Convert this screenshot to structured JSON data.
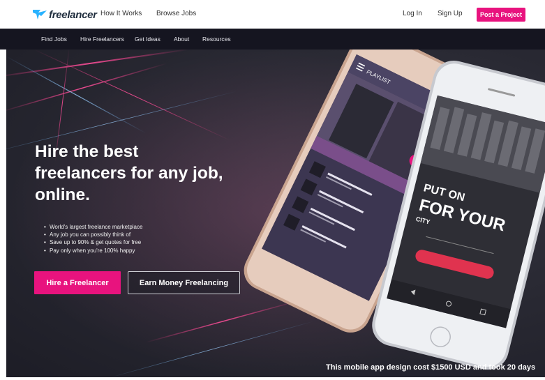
{
  "header": {
    "logo_text": "freelancer",
    "links": [
      "How It Works",
      "Browse Jobs"
    ],
    "login_label": "Log In",
    "signup_label": "Sign Up",
    "post_project_label": "Post a Project"
  },
  "nav": {
    "items": [
      "Find Jobs",
      "Hire Freelancers",
      "Get Ideas",
      "About",
      "Resources"
    ]
  },
  "hero": {
    "headline_lines": [
      "Hire the best",
      "freelancers for any job,",
      "online."
    ],
    "bullets": [
      "World's largest freelance marketplace",
      "Any job you can possibly think of",
      "Save up to 90% & get quotes for free",
      "Pay only when you're 100% happy"
    ],
    "hire_button": "Hire a Freelancer",
    "earn_button": "Earn Money Freelancing",
    "caption": "This mobile app design cost $1500 USD and took 20 days"
  },
  "phone_left": {
    "header": "PLAYLIST"
  },
  "phone_right": {
    "line1": "PUT ON",
    "line2": "FOR YOUR",
    "line3": "CITY"
  },
  "colors": {
    "brand_pink": "#e8137e",
    "nav_dark": "#151520",
    "hero_dark": "#2a2a34",
    "logo_blue": "#29b2fe"
  },
  "icons": [
    "freelancer-bird-logo-icon",
    "menu-icon",
    "search-icon",
    "back-nav-icon",
    "home-nav-icon",
    "recent-nav-icon"
  ]
}
